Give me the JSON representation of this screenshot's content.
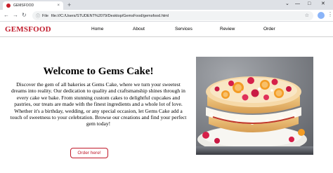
{
  "browser": {
    "tab_title": "GEMSFOOD",
    "tab_close": "×",
    "new_tab": "+",
    "url_scheme": "File",
    "url": "file:///C:/Users/STUDENT%2079/Desktop/GemsFood/gemsfood.html",
    "window_controls": [
      "⌄",
      "—",
      "□",
      "✕"
    ]
  },
  "site": {
    "brand": "GEMSFOOD",
    "nav": [
      "Home",
      "About",
      "Services",
      "Review",
      "Order"
    ]
  },
  "hero": {
    "title": "Welcome to Gems Cake!",
    "paragraph": "Discover the gem of all bakeries at Gems Cake, where we turn your sweetest dreams into reality. Our dedication to quality and craftsmanship shines through in every cake we bake. From stunning custom cakes to delightful cupcakes and pastries, our treats are made with the finest ingredients and a whole lot of love. Whether it's a birthday, wedding, or any special occasion, let Gems Cake add a touch of sweetness to your celebration. Browse our creations and find your perfect gem today!",
    "cta": "Order here!"
  },
  "colors": {
    "brand": "#c0192a",
    "chrome": "#dee1e6",
    "omnibox": "#f1f3f4"
  }
}
